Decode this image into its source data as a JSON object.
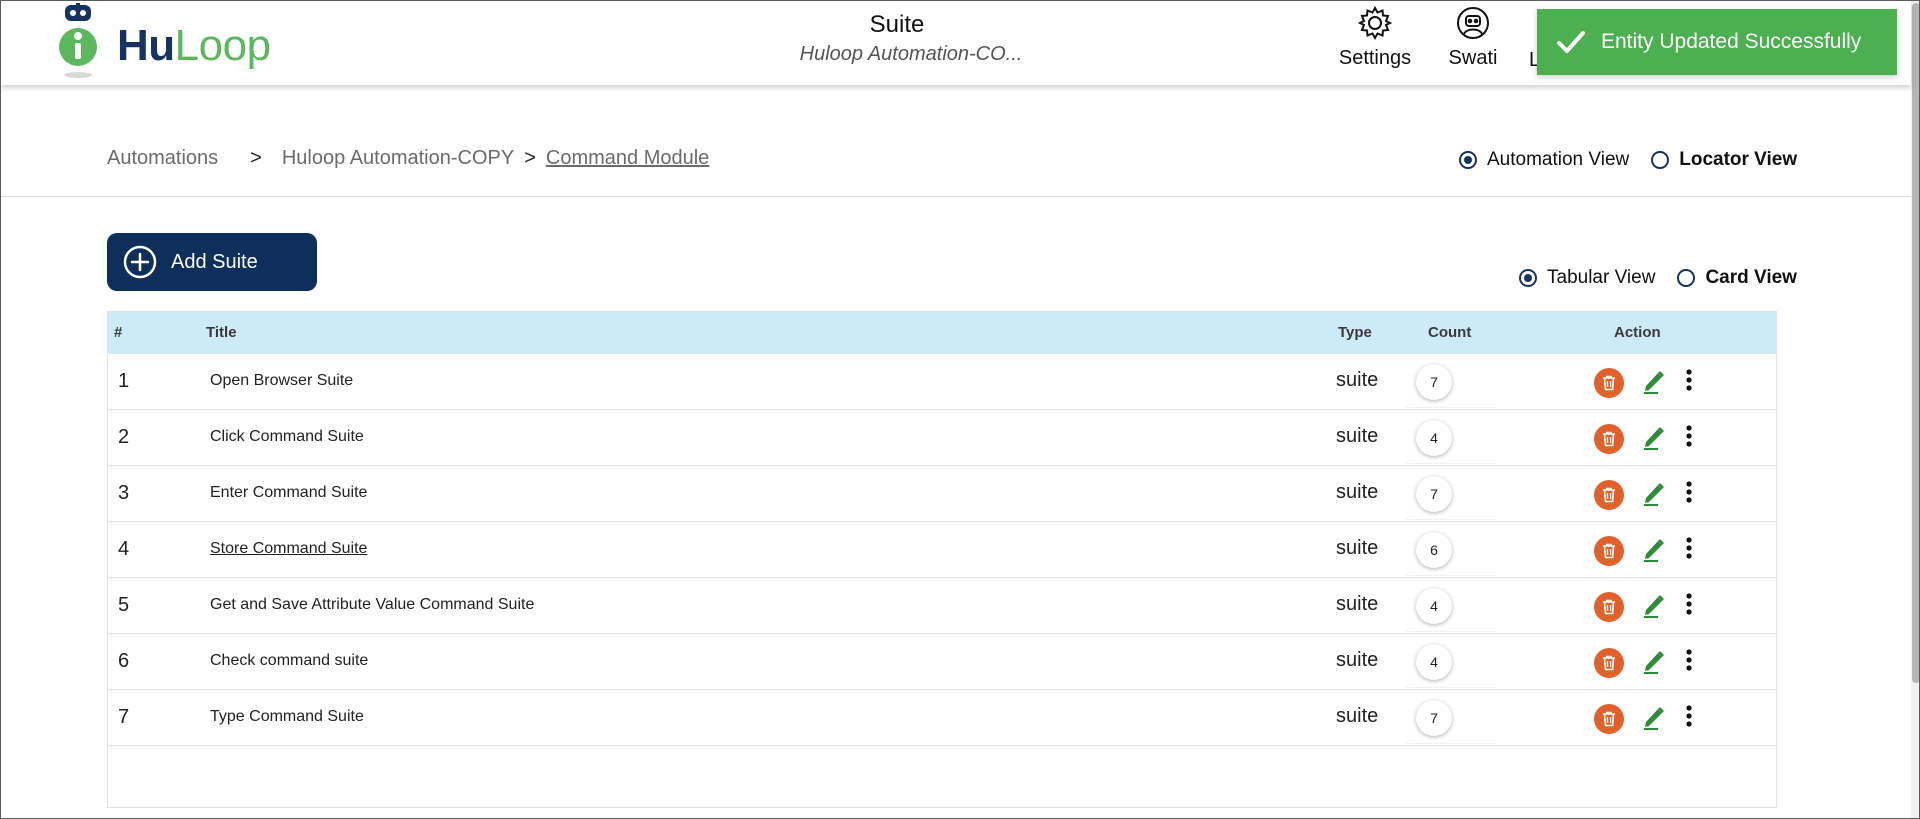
{
  "header": {
    "page_title": "Suite",
    "page_subtitle": "Huloop Automation-CO...",
    "logo": {
      "part1": "Hu",
      "part2": "Loop"
    },
    "nav": [
      {
        "label": "Settings",
        "icon": "gear-icon"
      },
      {
        "label": "Swati",
        "icon": "user-avatar-icon"
      },
      {
        "label": "L",
        "icon": ""
      }
    ]
  },
  "toast": {
    "message": "Entity Updated Successfully",
    "icon": "check-icon",
    "color": "#4caf50"
  },
  "breadcrumb": {
    "items": [
      "Automations",
      "Huloop Automation-COPY",
      "Command Module"
    ],
    "separators": [
      ">",
      ">"
    ]
  },
  "top_view_toggle": {
    "options": [
      {
        "label": "Automation View",
        "selected": true
      },
      {
        "label": "Locator View",
        "selected": false
      }
    ]
  },
  "add_button": {
    "label": "Add Suite",
    "icon": "plus-circle-icon"
  },
  "list_view_toggle": {
    "options": [
      {
        "label": "Tabular View",
        "selected": true
      },
      {
        "label": "Card View",
        "selected": false
      }
    ]
  },
  "table": {
    "columns": [
      "#",
      "Title",
      "Type",
      "Count",
      "Action"
    ],
    "rows": [
      {
        "num": "1",
        "title": "Open Browser Suite",
        "type": "suite",
        "count": "7"
      },
      {
        "num": "2",
        "title": "Click Command Suite",
        "type": "suite",
        "count": "4"
      },
      {
        "num": "3",
        "title": "Enter Command Suite",
        "type": "suite",
        "count": "7"
      },
      {
        "num": "4",
        "title": "Store Command Suite",
        "type": "suite",
        "count": "6"
      },
      {
        "num": "5",
        "title": "Get and Save Attribute Value Command Suite",
        "type": "suite",
        "count": "4"
      },
      {
        "num": "6",
        "title": "Check command suite",
        "type": "suite",
        "count": "4"
      },
      {
        "num": "7",
        "title": "Type Command Suite",
        "type": "suite",
        "count": "7"
      }
    ]
  },
  "colors": {
    "primary": "#0e2f5c",
    "header_row": "#cdeaf8",
    "delete": "#e0622a",
    "edit": "#2e8b3a",
    "brand_green": "#5cb85c"
  }
}
